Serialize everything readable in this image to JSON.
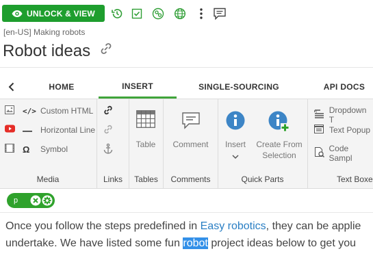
{
  "toolbar": {
    "unlock_label": "UNLOCK & VIEW",
    "icons": [
      "history-icon",
      "checkbox-icon",
      "workflow-icon",
      "globe-icon",
      "more-vertical-icon",
      "comment-icon"
    ]
  },
  "breadcrumb": "[en-US] Making robots",
  "page_title": "Robot ideas",
  "tabs": [
    {
      "label": "HOME",
      "active": false
    },
    {
      "label": "INSERT",
      "active": true
    },
    {
      "label": "SINGLE-SOURCING",
      "active": false
    },
    {
      "label": "API DOCS",
      "active": false
    }
  ],
  "ribbon": {
    "media": {
      "label": "Media",
      "items": [
        {
          "label": "Custom HTML",
          "icon": "code-icon"
        },
        {
          "label": "Horizontal Line",
          "icon": "horizontal-line-icon"
        },
        {
          "label": "Symbol",
          "icon": "omega-icon"
        }
      ]
    },
    "links": {
      "label": "Links"
    },
    "tables": {
      "label": "Tables",
      "button": "Table"
    },
    "comments": {
      "label": "Comments",
      "button": "Comment"
    },
    "quick_parts": {
      "label": "Quick Parts",
      "insert": "Insert",
      "create": "Create From Selection",
      "create_line1": "Create From",
      "create_line2": "Selection"
    },
    "text_boxes": {
      "label": "Text Boxe",
      "items": [
        {
          "label": "Dropdown T",
          "icon": "dropdown-text-icon"
        },
        {
          "label": "Text Popup",
          "icon": "text-popup-icon"
        },
        {
          "label": "Code Sampl",
          "icon": "code-sample-icon"
        }
      ]
    }
  },
  "tag_pill": {
    "tag": "p"
  },
  "content": {
    "line1_before": "Once you follow the steps predefined in ",
    "line1_link": "Easy robotics",
    "line1_after": ", they can be applie",
    "line2_before": "undertake. We have listed some fun ",
    "line2_selected": "robot",
    "line2_after": " project ideas below to get you"
  },
  "colors": {
    "accent": "#1e9e2e",
    "link": "#2a7fc4",
    "selection": "#3390e8",
    "info_blue": "#3d85c6"
  }
}
